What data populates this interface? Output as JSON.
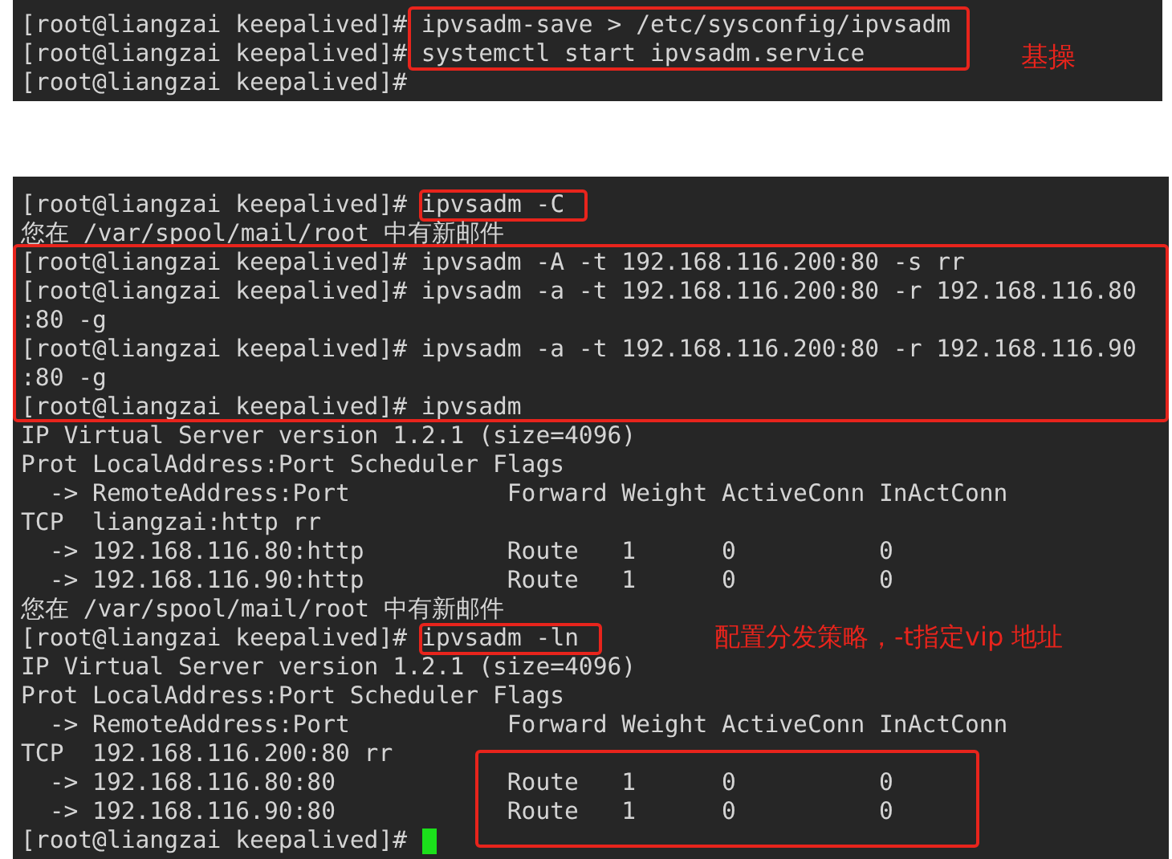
{
  "top_terminal": {
    "lines": [
      "[root@liangzai keepalived]# ipvsadm-save > /etc/sysconfig/ipvsadm",
      "[root@liangzai keepalived]# systemctl start ipvsadm.service",
      "[root@liangzai keepalived]#"
    ],
    "annotation": "基操"
  },
  "bottom_terminal": {
    "lines": [
      {
        "prompt": "[root@liangzai keepalived]#",
        "command": "ipvsadm -C",
        "boxed": true
      },
      "您在 /var/spool/mail/root 中有新邮件",
      "[root@liangzai keepalived]# ipvsadm -A -t 192.168.116.200:80 -s rr",
      "[root@liangzai keepalived]# ipvsadm -a -t 192.168.116.200:80 -r 192.168.116.80",
      ":80 -g",
      "[root@liangzai keepalived]# ipvsadm -a -t 192.168.116.200:80 -r 192.168.116.90",
      ":80 -g",
      "[root@liangzai keepalived]# ipvsadm",
      "IP Virtual Server version 1.2.1 (size=4096)",
      "Prot LocalAddress:Port Scheduler Flags",
      "  -> RemoteAddress:Port           Forward Weight ActiveConn InActConn",
      "TCP  liangzai:http rr",
      "  -> 192.168.116.80:http          Route   1      0          0",
      "  -> 192.168.116.90:http          Route   1      0          0",
      "您在 /var/spool/mail/root 中有新邮件",
      {
        "prompt": "[root@liangzai keepalived]#",
        "command": "ipvsadm -ln",
        "boxed": true
      },
      "IP Virtual Server version 1.2.1 (size=4096)",
      "Prot LocalAddress:Port Scheduler Flags",
      "  -> RemoteAddress:Port           Forward Weight ActiveConn InActConn",
      "TCP  192.168.116.200:80 rr",
      "  -> 192.168.116.80:80            Route   1      0          0",
      "  -> 192.168.116.90:80            Route   1      0          0",
      "[root@liangzai keepalived]#"
    ],
    "annotation": "配置分发策略，-t指定vip 地址",
    "cursor_visible": true
  }
}
